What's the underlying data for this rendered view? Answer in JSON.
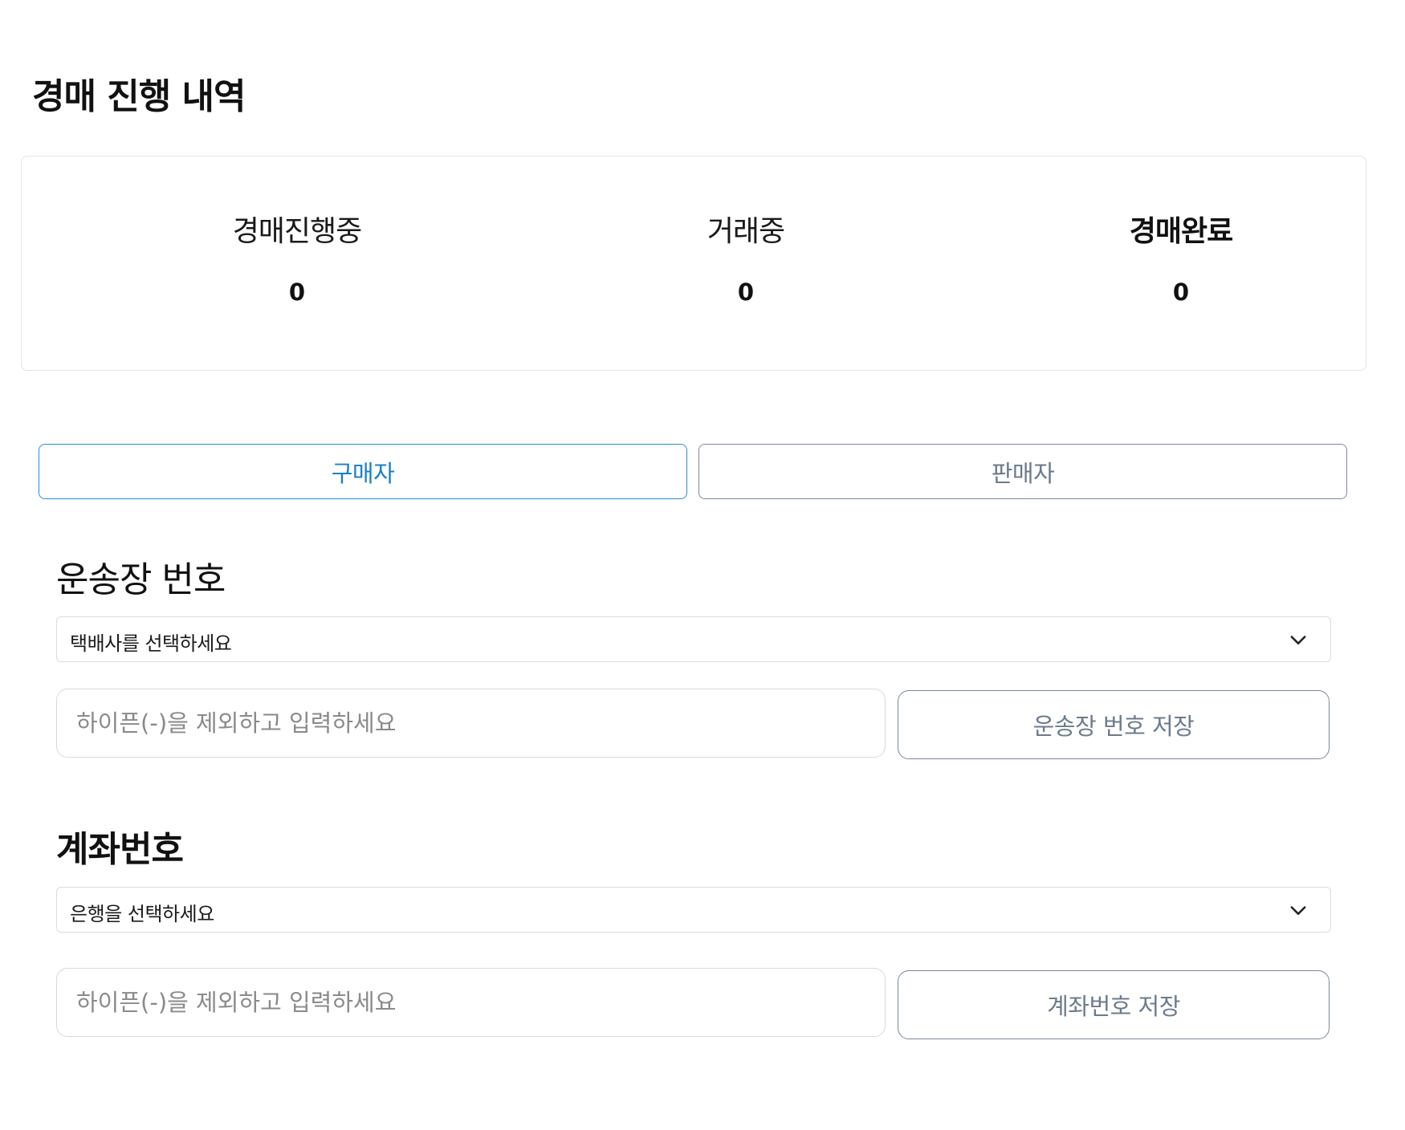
{
  "page": {
    "title": "경매 진행 내역"
  },
  "summary": {
    "stats": [
      {
        "label": "경매진행중",
        "value": "0"
      },
      {
        "label": "거래중",
        "value": "0"
      },
      {
        "label": "경매완료",
        "value": "0"
      }
    ],
    "active_index": 2
  },
  "tabs": {
    "buyer_label": "구매자",
    "seller_label": "판매자",
    "selected": "buyer"
  },
  "invoice": {
    "title": "운송장 번호",
    "courier_select_value": "택배사를 선택하세요",
    "input_placeholder": "하이픈(-)을 제외하고 입력하세요",
    "input_value": "",
    "save_label": "운송장 번호 저장"
  },
  "account": {
    "title": "계좌번호",
    "bank_select_value": "은행을 선택하세요",
    "input_placeholder": "하이픈(-)을 제외하고 입력하세요",
    "input_value": "",
    "save_label": "계좌번호 저장"
  },
  "icons": {
    "select_chevron": "chevron-down-icon"
  },
  "colors": {
    "buyer_tab_accent": "#1b80c4",
    "seller_tab_accent": "#6a7a8c",
    "border_light": "#dcdcdc"
  }
}
